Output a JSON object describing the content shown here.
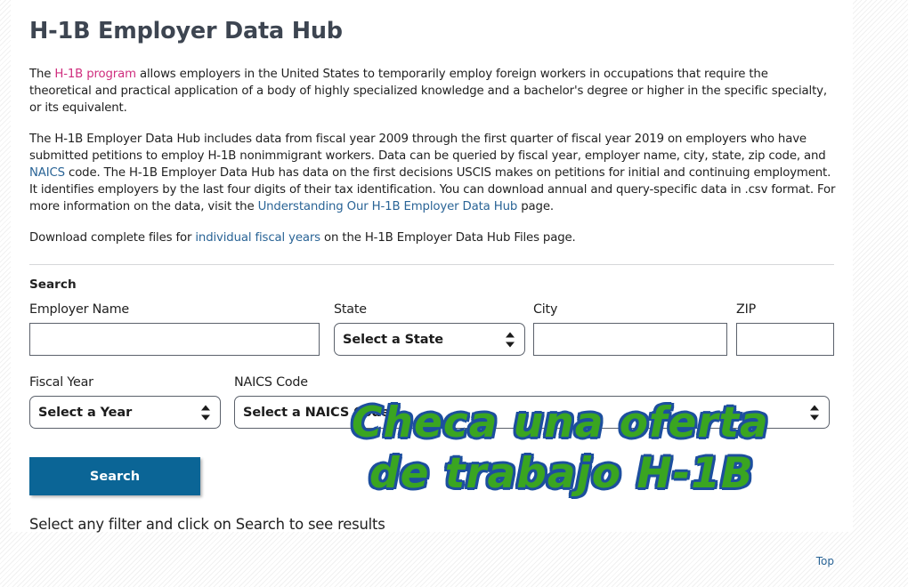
{
  "page": {
    "title": "H-1B Employer Data Hub",
    "search_heading": "Search"
  },
  "paragraphs": {
    "intro": {
      "before_link": "The ",
      "link": "H-1B program",
      "after_link": " allows employers in the United States to temporarily employ foreign workers in occupations that require the theoretical and practical application of a body of highly specialized knowledge and a bachelor's degree or higher in the specific specialty, or its equivalent."
    },
    "hub": {
      "part1": "The H-1B Employer Data Hub includes data from fiscal year 2009 through the first quarter of fiscal year 2019 on employers who have submitted petitions to employ H-1B nonimmigrant workers. Data can be queried by fiscal year, employer name, city, state, zip code, and ",
      "link1": "NAICS",
      "part2": " code. The H-1B Employer Data Hub has data on the first decisions USCIS makes on petitions for initial and continuing employment. It identifies employers by the last four digits of their tax identification. You can download annual and query-specific data in .csv format. For more information on the data, visit the ",
      "link2": "Understanding Our H-1B Employer Data Hub",
      "part3": " page."
    },
    "files": {
      "part1": "Download complete files for ",
      "link1": "individual fiscal years",
      "part2": " on the H-1B Employer Data Hub Files page."
    }
  },
  "form": {
    "employer_name": {
      "label": "Employer Name",
      "value": "",
      "placeholder": ""
    },
    "state": {
      "label": "State",
      "selected": "Select a State"
    },
    "city": {
      "label": "City",
      "value": "",
      "placeholder": ""
    },
    "zip": {
      "label": "ZIP",
      "value": "",
      "placeholder": ""
    },
    "fiscal_year": {
      "label": "Fiscal Year",
      "selected": "Select a Year"
    },
    "naics_code": {
      "label": "NAICS Code",
      "selected": "Select a NAICS Code"
    },
    "search_button": "Search",
    "results_hint": "Select any filter and click on Search to see results"
  },
  "footer": {
    "top_link": "Top"
  },
  "overlay": {
    "line1": "Checa una oferta",
    "line2": "de trabajo H-1B",
    "fill_color": "#3aa521",
    "outline_color": "#1d4f9e"
  },
  "colors": {
    "accent_button": "#0b6596",
    "link": "#2a6496",
    "visited_link": "#cf2e7e",
    "title": "#3d4551"
  }
}
